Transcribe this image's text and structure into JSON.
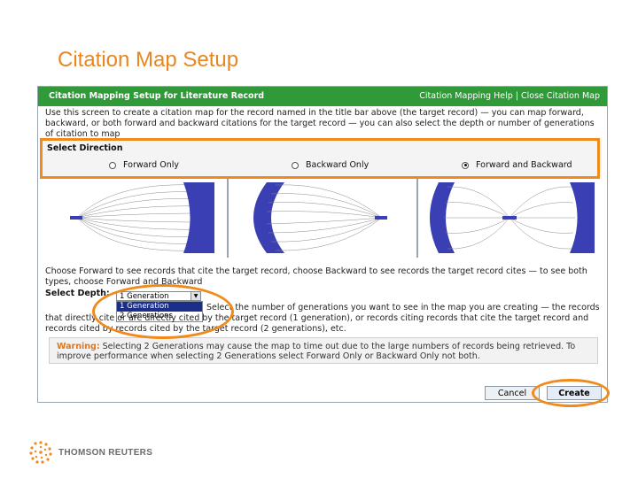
{
  "slide": {
    "title": "Citation Map Setup"
  },
  "window": {
    "title": "Citation Mapping Setup for Literature Record",
    "help_link": "Citation Mapping Help",
    "separator": "|",
    "close_link": "Close Citation Map"
  },
  "intro_text": "Use this screen to create a citation map for the record named in the title bar above (the target record) — you can map forward, backward, or both forward and backward citations for the target record — you can also select the depth or number of generations of citation to map",
  "direction": {
    "heading": "Select Direction",
    "options": [
      {
        "label": "Forward Only",
        "selected": false
      },
      {
        "label": "Backward Only",
        "selected": false
      },
      {
        "label": "Forward and Backward",
        "selected": true
      }
    ]
  },
  "direction_help": "Choose Forward to see records that cite the target record, choose Backward to see records the target record cites — to see both types, choose Forward and Backward",
  "depth": {
    "label": "Select Depth:",
    "selected": "1 Generation",
    "options": [
      "1 Generation",
      "2 Generations"
    ],
    "help": "Select the number of generations you want to see in the map you are creating — the records that directly cite or are directly cited by the target record (1 generation), or records citing records that cite the target record and records cited by records cited by the target record (2 generations), etc."
  },
  "warning": {
    "label": "Warning:",
    "text": "Selecting 2 Generations may cause the map to time out due to the large numbers of records being retrieved. To improve performance when selecting 2 Generations select Forward Only or Backward Only not both."
  },
  "buttons": {
    "cancel": "Cancel",
    "create": "Create"
  },
  "brand": {
    "name": "THOMSON REUTERS"
  },
  "colors": {
    "accent": "#f08a1c",
    "titlebar": "#2f9a37",
    "map": "#3a3fb4",
    "title_text": "#e8861f"
  }
}
